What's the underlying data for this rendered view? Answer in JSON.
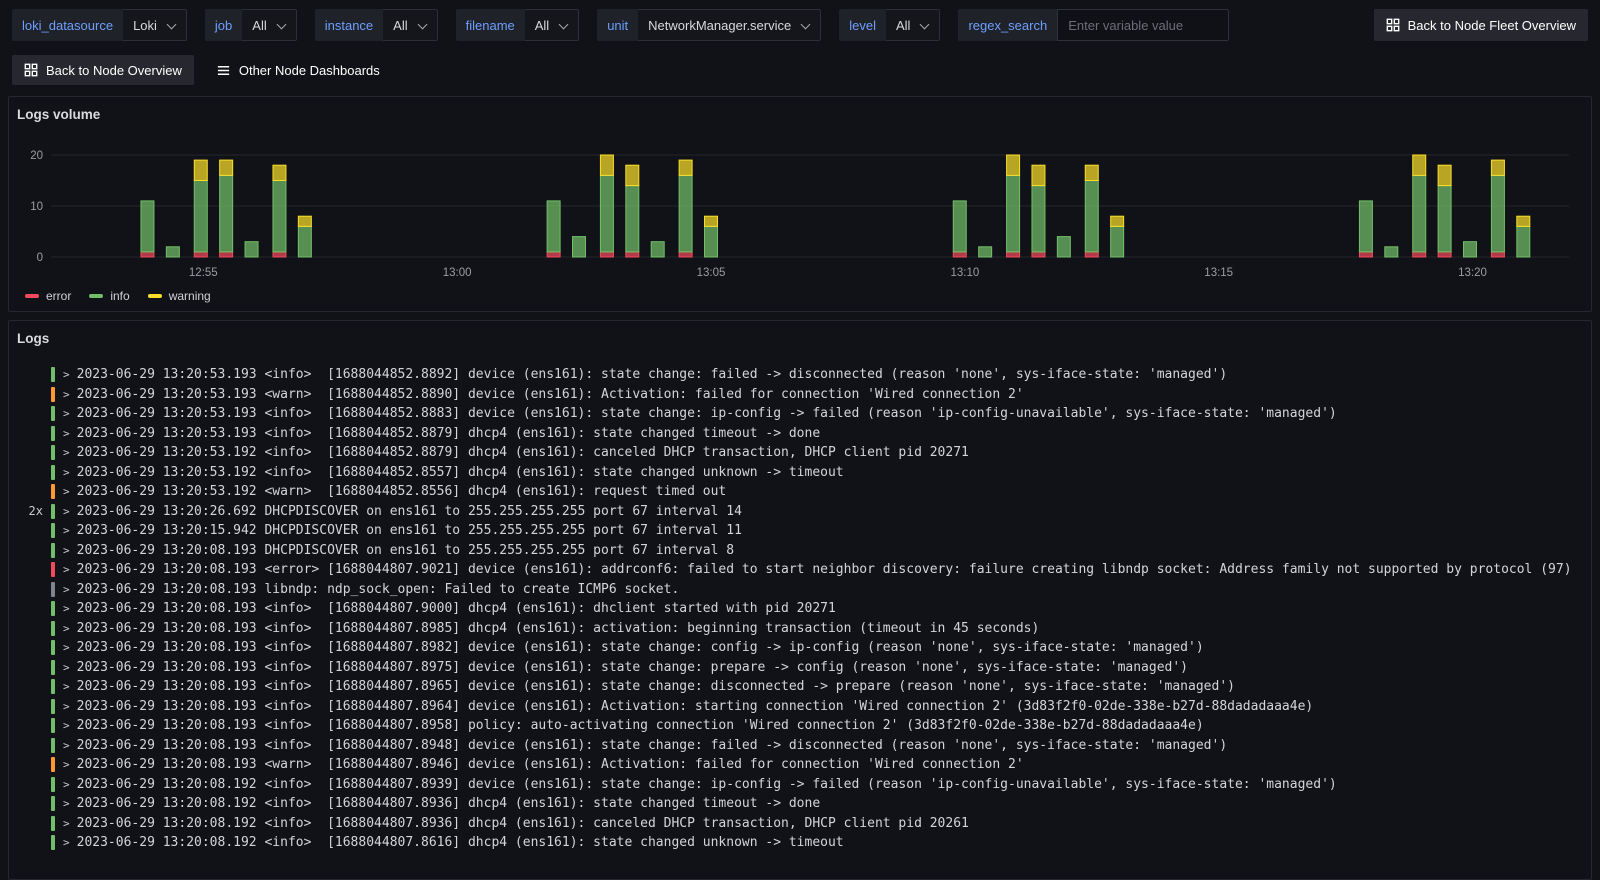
{
  "variables": [
    {
      "label": "loki_datasource",
      "type": "select",
      "value": "Loki"
    },
    {
      "label": "job",
      "type": "select",
      "value": "All"
    },
    {
      "label": "instance",
      "type": "select",
      "value": "All"
    },
    {
      "label": "filename",
      "type": "select",
      "value": "All"
    },
    {
      "label": "unit",
      "type": "select",
      "value": "NetworkManager.service"
    },
    {
      "label": "level",
      "type": "select",
      "value": "All"
    },
    {
      "label": "regex_search",
      "type": "input",
      "value": "",
      "placeholder": "Enter variable value"
    }
  ],
  "toolbar": {
    "fleet_overview_button": "Back to Node Fleet Overview",
    "node_overview_button": "Back to Node Overview",
    "other_dashboards_link": "Other Node Dashboards"
  },
  "logs_volume_panel": {
    "title": "Logs volume",
    "legend": [
      {
        "label": "error",
        "color": "#F2495C"
      },
      {
        "label": "info",
        "color": "#73BF69"
      },
      {
        "label": "warning",
        "color": "#FADE2A"
      }
    ],
    "chart_data": {
      "type": "bar",
      "stacked": true,
      "x_axis": "time",
      "x_range": [
        52.0,
        81.9
      ],
      "ylim": [
        0,
        20
      ],
      "yticks": [
        0,
        10,
        20
      ],
      "grid": "horizontal",
      "legend_position": "bottom-left",
      "series_colors": {
        "error": "#F2495C",
        "info": "#73BF69",
        "warning": "#FADE2A"
      },
      "xticks": [
        {
          "t": 55,
          "label": "12:55"
        },
        {
          "t": 60,
          "label": "13:00"
        },
        {
          "t": 65,
          "label": "13:05"
        },
        {
          "t": 70,
          "label": "13:10"
        },
        {
          "t": 75,
          "label": "13:15"
        },
        {
          "t": 80,
          "label": "13:20"
        }
      ],
      "bars": [
        {
          "t": 53.9,
          "error": 1,
          "info": 10,
          "warning": 0
        },
        {
          "t": 54.4,
          "error": 0,
          "info": 2,
          "warning": 0
        },
        {
          "t": 54.95,
          "error": 1,
          "info": 14,
          "warning": 4
        },
        {
          "t": 55.45,
          "error": 1,
          "info": 15,
          "warning": 3
        },
        {
          "t": 55.95,
          "error": 0,
          "info": 3,
          "warning": 0
        },
        {
          "t": 56.5,
          "error": 1,
          "info": 14,
          "warning": 3
        },
        {
          "t": 57.0,
          "error": 0,
          "info": 6,
          "warning": 2
        },
        {
          "t": 61.9,
          "error": 1,
          "info": 10,
          "warning": 0
        },
        {
          "t": 62.4,
          "error": 0,
          "info": 4,
          "warning": 0
        },
        {
          "t": 62.95,
          "error": 1,
          "info": 15,
          "warning": 4
        },
        {
          "t": 63.45,
          "error": 1,
          "info": 13,
          "warning": 4
        },
        {
          "t": 63.95,
          "error": 0,
          "info": 3,
          "warning": 0
        },
        {
          "t": 64.5,
          "error": 1,
          "info": 15,
          "warning": 3
        },
        {
          "t": 65.0,
          "error": 0,
          "info": 6,
          "warning": 2
        },
        {
          "t": 69.9,
          "error": 1,
          "info": 10,
          "warning": 0
        },
        {
          "t": 70.4,
          "error": 0,
          "info": 2,
          "warning": 0
        },
        {
          "t": 70.95,
          "error": 1,
          "info": 15,
          "warning": 4
        },
        {
          "t": 71.45,
          "error": 1,
          "info": 13,
          "warning": 4
        },
        {
          "t": 71.95,
          "error": 0,
          "info": 4,
          "warning": 0
        },
        {
          "t": 72.5,
          "error": 1,
          "info": 14,
          "warning": 3
        },
        {
          "t": 73.0,
          "error": 0,
          "info": 6,
          "warning": 2
        },
        {
          "t": 77.9,
          "error": 1,
          "info": 10,
          "warning": 0
        },
        {
          "t": 78.4,
          "error": 0,
          "info": 2,
          "warning": 0
        },
        {
          "t": 78.95,
          "error": 1,
          "info": 15,
          "warning": 4
        },
        {
          "t": 79.45,
          "error": 1,
          "info": 13,
          "warning": 4
        },
        {
          "t": 79.95,
          "error": 0,
          "info": 3,
          "warning": 0
        },
        {
          "t": 80.5,
          "error": 1,
          "info": 15,
          "warning": 3
        },
        {
          "t": 81.0,
          "error": 0,
          "info": 6,
          "warning": 2
        }
      ]
    }
  },
  "logs_panel": {
    "title": "Logs",
    "level_colors": {
      "info": "#73BF69",
      "warn": "#FF9830",
      "error": "#F2495C",
      "unknown": "#7e838c"
    },
    "rows": [
      {
        "level": "info",
        "dup": "",
        "text": "2023-06-29 13:20:53.193 <info>  [1688044852.8892] device (ens161): state change: failed -> disconnected (reason 'none', sys-iface-state: 'managed')"
      },
      {
        "level": "warn",
        "dup": "",
        "text": "2023-06-29 13:20:53.193 <warn>  [1688044852.8890] device (ens161): Activation: failed for connection 'Wired connection 2'"
      },
      {
        "level": "info",
        "dup": "",
        "text": "2023-06-29 13:20:53.193 <info>  [1688044852.8883] device (ens161): state change: ip-config -> failed (reason 'ip-config-unavailable', sys-iface-state: 'managed')"
      },
      {
        "level": "info",
        "dup": "",
        "text": "2023-06-29 13:20:53.193 <info>  [1688044852.8879] dhcp4 (ens161): state changed timeout -> done"
      },
      {
        "level": "info",
        "dup": "",
        "text": "2023-06-29 13:20:53.192 <info>  [1688044852.8879] dhcp4 (ens161): canceled DHCP transaction, DHCP client pid 20271"
      },
      {
        "level": "info",
        "dup": "",
        "text": "2023-06-29 13:20:53.192 <info>  [1688044852.8557] dhcp4 (ens161): state changed unknown -> timeout"
      },
      {
        "level": "warn",
        "dup": "",
        "text": "2023-06-29 13:20:53.192 <warn>  [1688044852.8556] dhcp4 (ens161): request timed out"
      },
      {
        "level": "info",
        "dup": "2x",
        "text": "2023-06-29 13:20:26.692 DHCPDISCOVER on ens161 to 255.255.255.255 port 67 interval 14"
      },
      {
        "level": "info",
        "dup": "",
        "text": "2023-06-29 13:20:15.942 DHCPDISCOVER on ens161 to 255.255.255.255 port 67 interval 11"
      },
      {
        "level": "info",
        "dup": "",
        "text": "2023-06-29 13:20:08.193 DHCPDISCOVER on ens161 to 255.255.255.255 port 67 interval 8"
      },
      {
        "level": "error",
        "dup": "",
        "text": "2023-06-29 13:20:08.193 <error> [1688044807.9021] device (ens161): addrconf6: failed to start neighbor discovery: failure creating libndp socket: Address family not supported by protocol (97)"
      },
      {
        "level": "unknown",
        "dup": "",
        "text": "2023-06-29 13:20:08.193 libndp: ndp_sock_open: Failed to create ICMP6 socket."
      },
      {
        "level": "info",
        "dup": "",
        "text": "2023-06-29 13:20:08.193 <info>  [1688044807.9000] dhcp4 (ens161): dhclient started with pid 20271"
      },
      {
        "level": "info",
        "dup": "",
        "text": "2023-06-29 13:20:08.193 <info>  [1688044807.8985] dhcp4 (ens161): activation: beginning transaction (timeout in 45 seconds)"
      },
      {
        "level": "info",
        "dup": "",
        "text": "2023-06-29 13:20:08.193 <info>  [1688044807.8982] device (ens161): state change: config -> ip-config (reason 'none', sys-iface-state: 'managed')"
      },
      {
        "level": "info",
        "dup": "",
        "text": "2023-06-29 13:20:08.193 <info>  [1688044807.8975] device (ens161): state change: prepare -> config (reason 'none', sys-iface-state: 'managed')"
      },
      {
        "level": "info",
        "dup": "",
        "text": "2023-06-29 13:20:08.193 <info>  [1688044807.8965] device (ens161): state change: disconnected -> prepare (reason 'none', sys-iface-state: 'managed')"
      },
      {
        "level": "info",
        "dup": "",
        "text": "2023-06-29 13:20:08.193 <info>  [1688044807.8964] device (ens161): Activation: starting connection 'Wired connection 2' (3d83f2f0-02de-338e-b27d-88dadadaaa4e)"
      },
      {
        "level": "info",
        "dup": "",
        "text": "2023-06-29 13:20:08.193 <info>  [1688044807.8958] policy: auto-activating connection 'Wired connection 2' (3d83f2f0-02de-338e-b27d-88dadadaaa4e)"
      },
      {
        "level": "info",
        "dup": "",
        "text": "2023-06-29 13:20:08.193 <info>  [1688044807.8948] device (ens161): state change: failed -> disconnected (reason 'none', sys-iface-state: 'managed')"
      },
      {
        "level": "warn",
        "dup": "",
        "text": "2023-06-29 13:20:08.193 <warn>  [1688044807.8946] device (ens161): Activation: failed for connection 'Wired connection 2'"
      },
      {
        "level": "info",
        "dup": "",
        "text": "2023-06-29 13:20:08.192 <info>  [1688044807.8939] device (ens161): state change: ip-config -> failed (reason 'ip-config-unavailable', sys-iface-state: 'managed')"
      },
      {
        "level": "info",
        "dup": "",
        "text": "2023-06-29 13:20:08.192 <info>  [1688044807.8936] dhcp4 (ens161): state changed timeout -> done"
      },
      {
        "level": "info",
        "dup": "",
        "text": "2023-06-29 13:20:08.192 <info>  [1688044807.8936] dhcp4 (ens161): canceled DHCP transaction, DHCP client pid 20261"
      },
      {
        "level": "info",
        "dup": "",
        "text": "2023-06-29 13:20:08.192 <info>  [1688044807.8616] dhcp4 (ens161): state changed unknown -> timeout"
      }
    ]
  }
}
